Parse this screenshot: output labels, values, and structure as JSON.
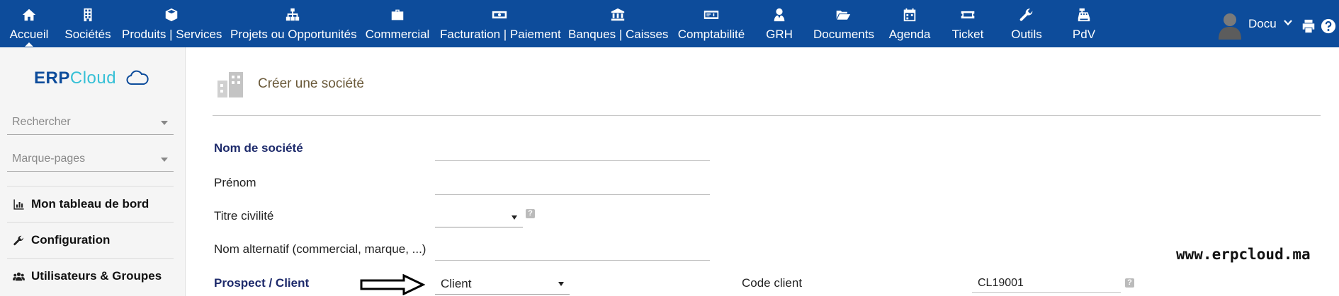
{
  "nav": {
    "items": [
      {
        "label": "Accueil",
        "icon": "home-icon"
      },
      {
        "label": "Sociétés",
        "icon": "building-icon"
      },
      {
        "label": "Produits | Services",
        "icon": "cube-icon"
      },
      {
        "label": "Projets ou Opportunités",
        "icon": "sitemap-icon"
      },
      {
        "label": "Commercial",
        "icon": "briefcase-icon"
      },
      {
        "label": "Facturation | Paiement",
        "icon": "money-bill-icon"
      },
      {
        "label": "Banques | Caisses",
        "icon": "bank-icon"
      },
      {
        "label": "Comptabilité",
        "icon": "money-check-icon"
      },
      {
        "label": "GRH",
        "icon": "user-tie-icon"
      },
      {
        "label": "Documents",
        "icon": "folder-open-icon"
      },
      {
        "label": "Agenda",
        "icon": "calendar-icon"
      },
      {
        "label": "Ticket",
        "icon": "ticket-icon"
      },
      {
        "label": "Outils",
        "icon": "wrench-icon"
      },
      {
        "label": "PdV",
        "icon": "cash-register-icon"
      }
    ],
    "active": "Accueil"
  },
  "user": {
    "name": "Docu"
  },
  "sidebar": {
    "logo_part1": "ERP",
    "logo_part2": "Cloud",
    "search_placeholder": "Rechercher",
    "bookmarks_placeholder": "Marque-pages",
    "links": [
      {
        "label": "Mon tableau de bord",
        "icon": "chart-bar-icon"
      },
      {
        "label": "Configuration",
        "icon": "wrench-icon"
      },
      {
        "label": "Utilisateurs & Groupes",
        "icon": "users-icon"
      }
    ]
  },
  "page": {
    "title": "Créer une société"
  },
  "form": {
    "company_name_label": "Nom de société",
    "firstname_label": "Prénom",
    "civility_label": "Titre civilité",
    "alt_name_label": "Nom alternatif (commercial, marque, ...)",
    "prospect_label": "Prospect / Client",
    "prospect_value": "Client",
    "client_code_label": "Code client",
    "client_code_value": "CL19001"
  },
  "watermark": "www.erpcloud.ma",
  "colors": {
    "topbar": "#0d4c9b",
    "accent_cloud": "#36c0d6",
    "required_label": "#1d2a6b"
  }
}
